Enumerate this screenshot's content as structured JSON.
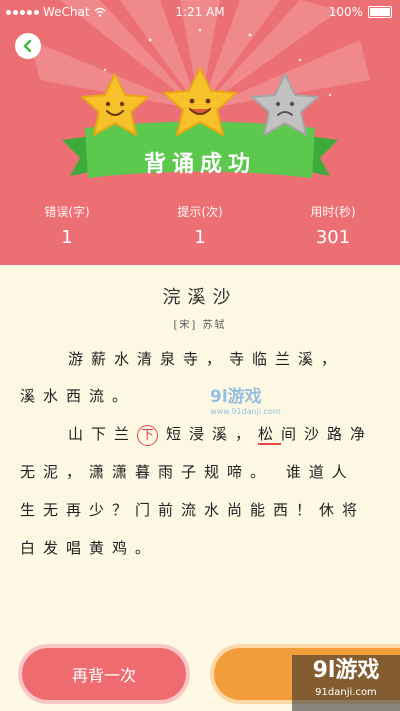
{
  "status_bar": {
    "carrier": "WeChat",
    "time": "1:21 AM",
    "battery": "100%"
  },
  "header": {
    "banner_text": "背诵成功",
    "stars_earned": 2,
    "stars_total": 3
  },
  "stats": [
    {
      "label": "错误(字)",
      "value": "1"
    },
    {
      "label": "提示(次)",
      "value": "1"
    },
    {
      "label": "用时(秒)",
      "value": "301"
    }
  ],
  "poem": {
    "title": "浣溪沙",
    "author": "[宋] 苏轼",
    "line1": "游薪水清泉寺，寺临兰溪，",
    "line2": "溪水西流。",
    "line3_pre": "山下兰",
    "line3_mark": "下",
    "line3_mid": "短浸溪，",
    "line3_under": "松",
    "line3_post": "间沙路净",
    "line4": "无泥，潇潇暮雨子规啼。 谁道人",
    "line5": "生无再少？门前流水尚能西！休将",
    "line6": "白发唱黄鸡。"
  },
  "buttons": {
    "retry": "再背一次"
  },
  "watermarks": {
    "mid_logo": "9l游戏",
    "mid_url": "www.91danji.com",
    "corner_logo": "9l游戏",
    "corner_url": "91danji.com"
  },
  "colors": {
    "header_bg": "#ec6f73",
    "page_bg": "#fdf8e4",
    "banner_green": "#5cc84e",
    "star_gold": "#f7c12b",
    "star_gray": "#b9b9b9",
    "error_red": "#e04848",
    "retry_button": "#ee6b70",
    "next_button": "#f29d3a"
  }
}
